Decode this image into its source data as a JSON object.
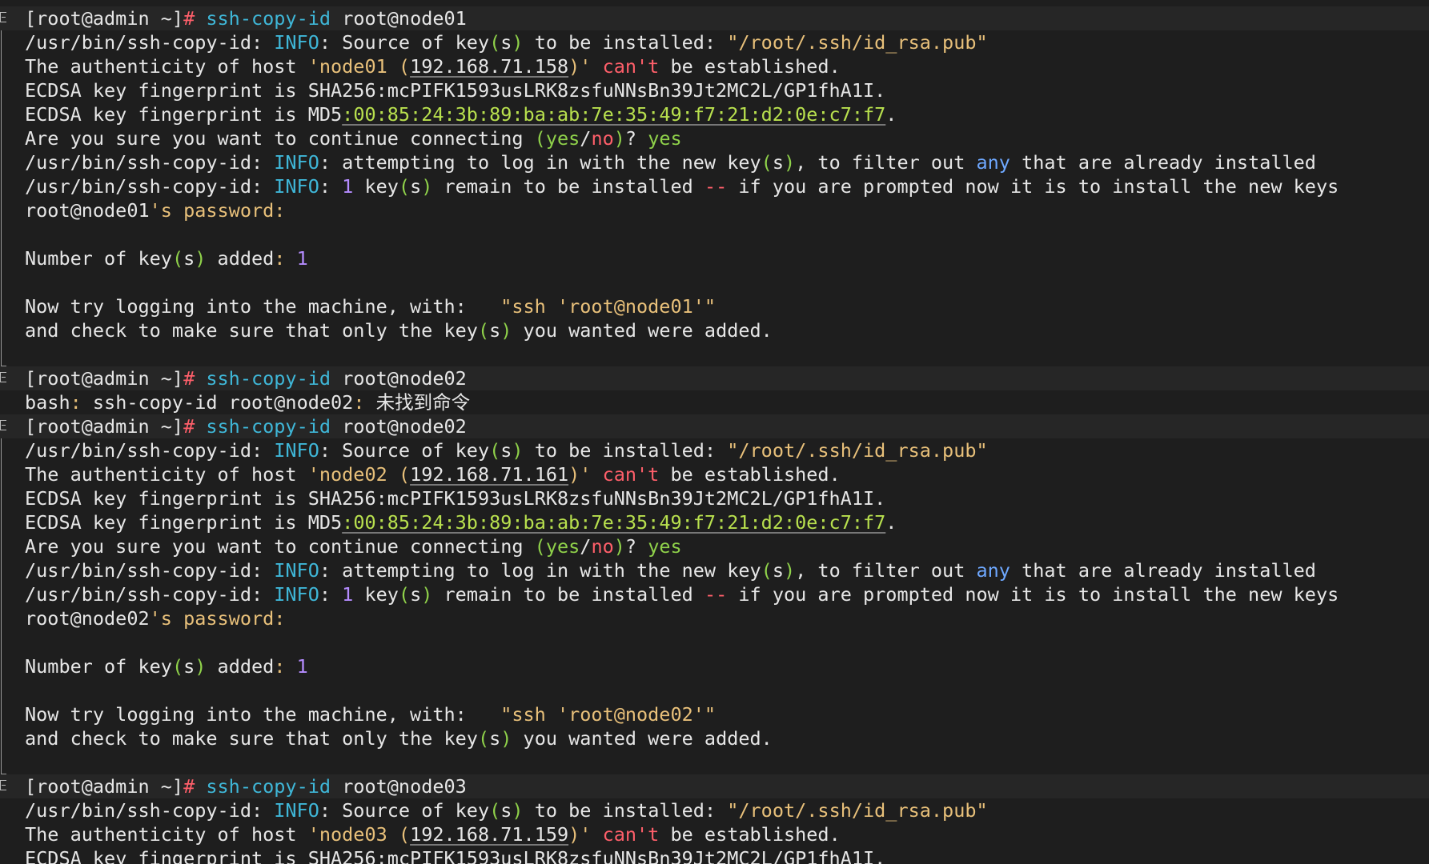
{
  "theme": {
    "background": "#1e1e1e",
    "text": "#e6e6e6",
    "cyan": "#3fb7d8",
    "red": "#ff5f6a",
    "green": "#8fd14a",
    "yellow": "#e8c07a",
    "purple": "#b58cff",
    "blue": "#6ea8ff"
  },
  "prompt": {
    "user_host": "[root@admin ~]",
    "hash": "#"
  },
  "tool": "/usr/bin/ssh-copy-id",
  "blocks": [
    {
      "command": "ssh-copy-id",
      "arg": "root@node01",
      "host": "node01",
      "ip": "192.168.71.158",
      "pubkey": "\"/root/.ssh/id_rsa.pub\"",
      "sha256": "SHA256:mcPIFK1593usLRK8zsfuNNsBn39Jt2MC2L/GP1fhA1I",
      "md5_prefix": "MD5",
      "md5": ":00:85:24:3b:89:ba:ab:7e:35:49:f7:21:d2:0e:c7:f7",
      "answer": "yes",
      "added_count": "1",
      "ssh_hint": "\"ssh 'root@node01'\"",
      "user_at_host": "root@node01"
    },
    {
      "error_prefix": "bash",
      "error_cmd": " ssh-copy-id root@node02",
      "error_msg": " 未找到命令"
    },
    {
      "command": "ssh-copy-id",
      "arg": "root@node02",
      "host": "node02",
      "ip": "192.168.71.161",
      "pubkey": "\"/root/.ssh/id_rsa.pub\"",
      "sha256": "SHA256:mcPIFK1593usLRK8zsfuNNsBn39Jt2MC2L/GP1fhA1I",
      "md5_prefix": "MD5",
      "md5": ":00:85:24:3b:89:ba:ab:7e:35:49:f7:21:d2:0e:c7:f7",
      "answer": "yes",
      "added_count": "1",
      "ssh_hint": "\"ssh 'root@node02'\"",
      "user_at_host": "root@node02"
    },
    {
      "command": "ssh-copy-id",
      "arg": "root@node03",
      "host": "node03",
      "ip": "192.168.71.159",
      "pubkey": "\"/root/.ssh/id_rsa.pub\"",
      "sha256": "SHA256:mcPIFK1593usLRK8zsfuNNsBn39Jt2MC2L/GP1fhA1I"
    }
  ],
  "text": {
    "info": "INFO",
    "source_of_key": " Source of key",
    "s": "s",
    "to_be_installed": " to be installed",
    "authenticity": "The authenticity of host ",
    "cant": "can't",
    "be_established": " be established.",
    "ecdsa_fp": "ECDSA key fingerprint is ",
    "are_you_sure": "Are you sure you want to continue connecting ",
    "yes": "yes",
    "no": "no",
    "attempting": " attempting to log in with the new key",
    "to_filter": ", to filter out ",
    "any": "any",
    "already": " that are already installed",
    "remain": " remain to be installed ",
    "dashdash": "--",
    "prompted": " if you are prompted now it is to install the new keys",
    "key": "key",
    "password": "'s password:",
    "number_of_keys": "Number of key",
    "added": " added",
    "now_try": "Now try logging into the machine, with:   ",
    "and_check": "and check to make sure that only the key",
    "you_wanted": " you wanted were added."
  }
}
